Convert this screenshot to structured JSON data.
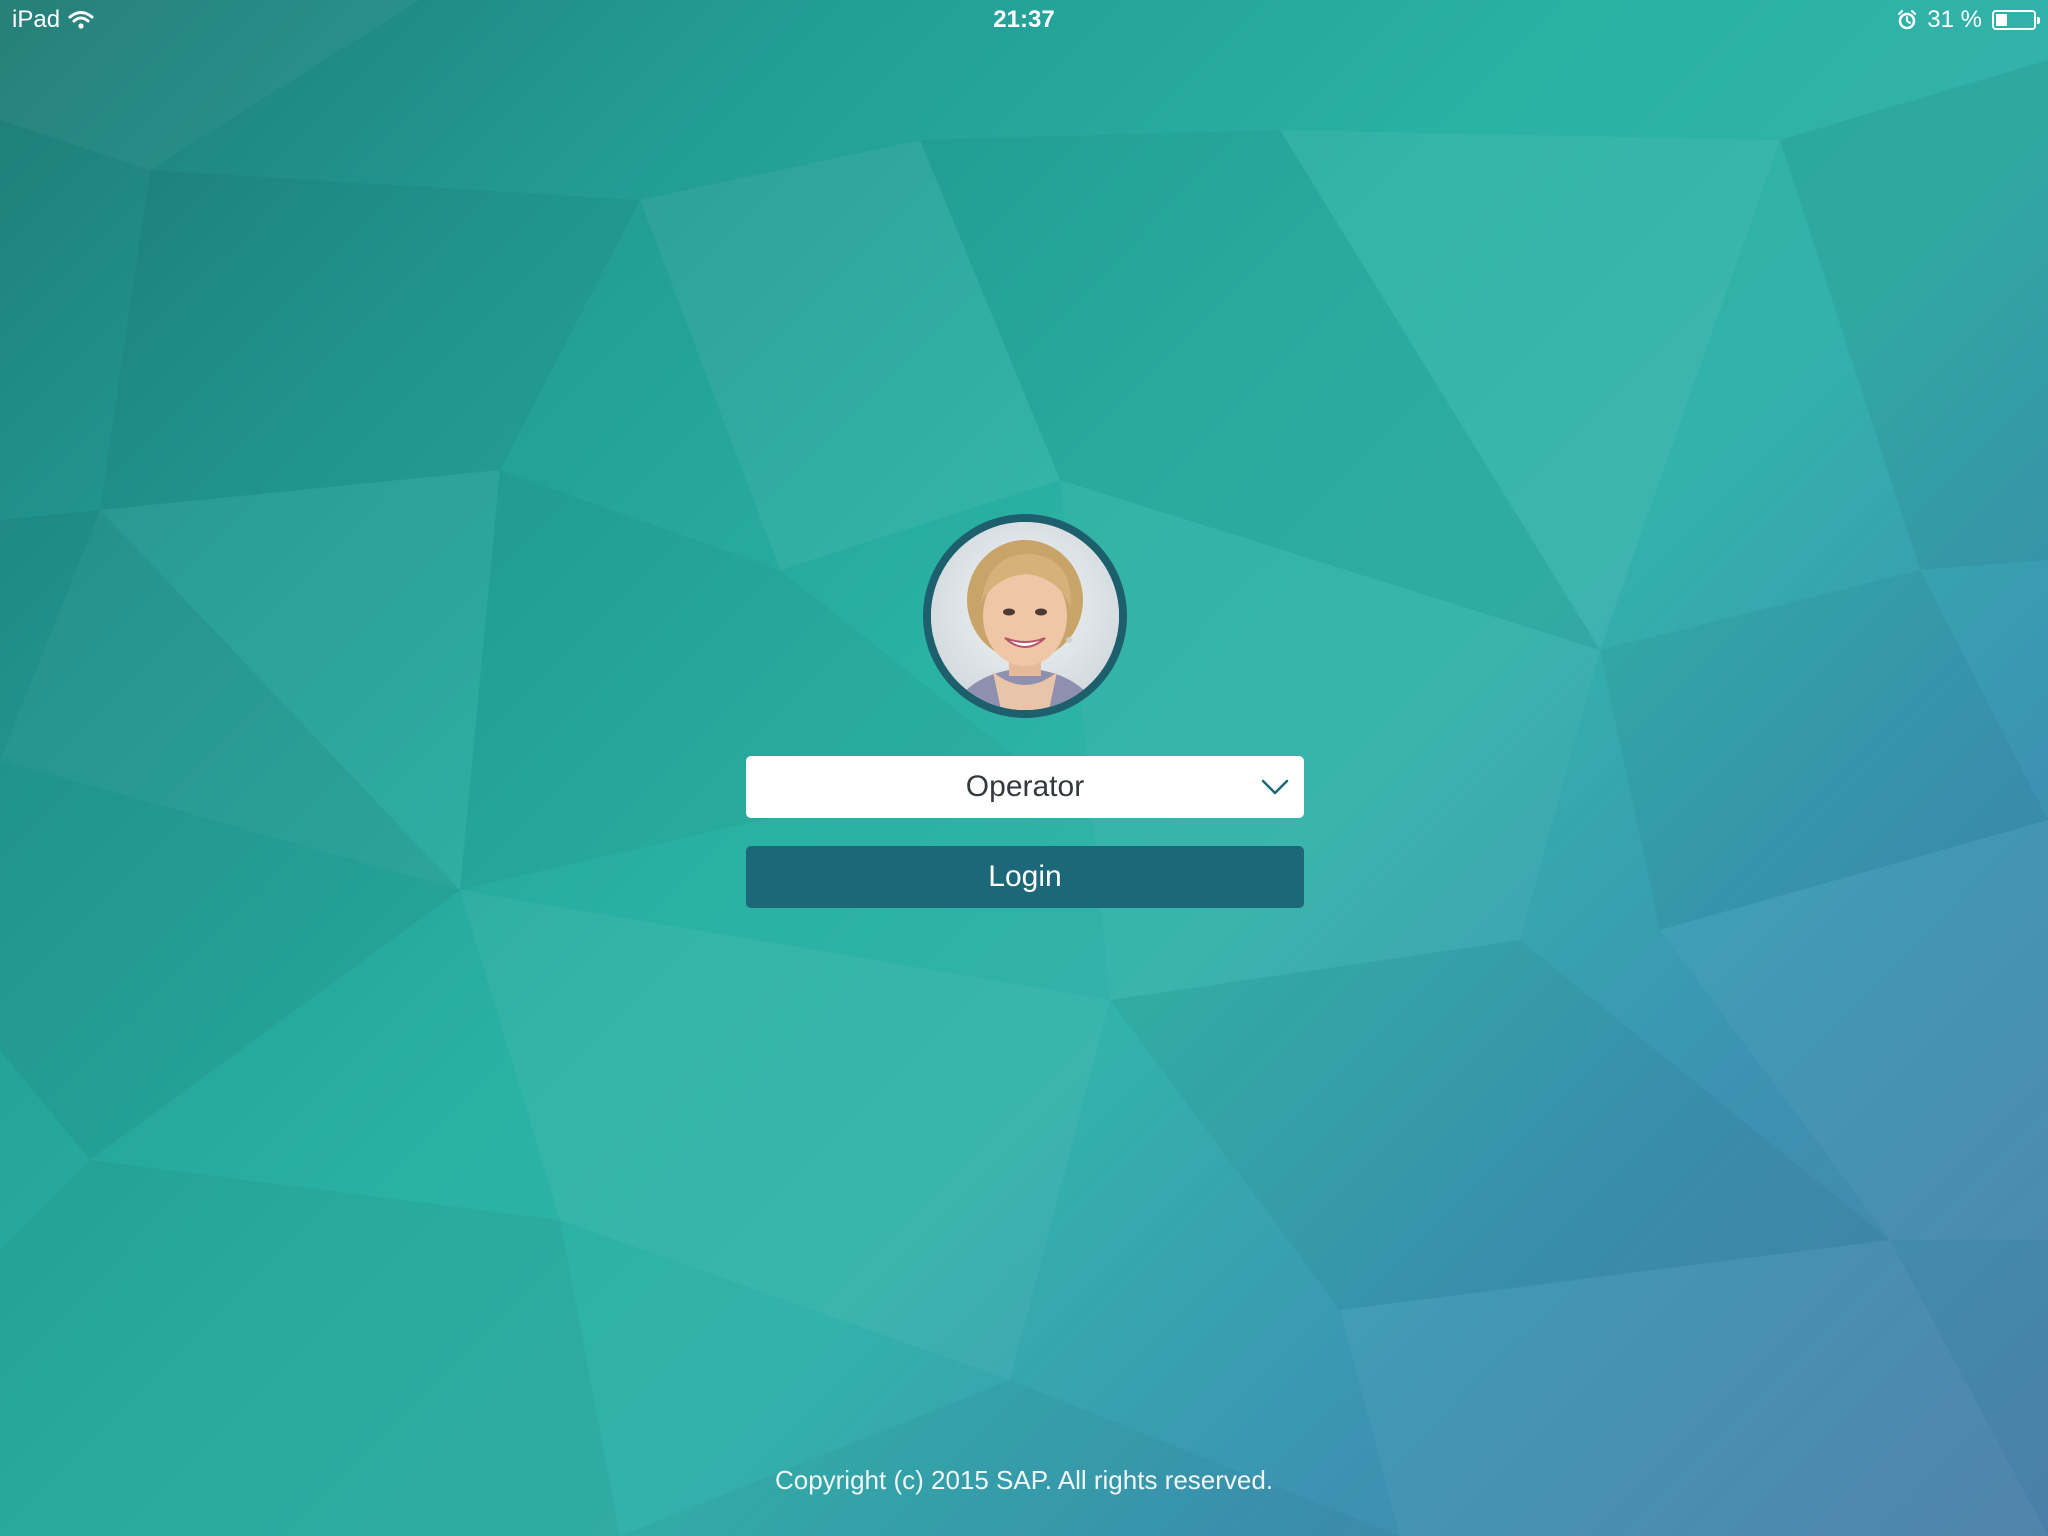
{
  "status_bar": {
    "device": "iPad",
    "time": "21:37",
    "battery_text": "31 %",
    "battery_level": 0.31,
    "icons": [
      "wifi-icon",
      "alarm-icon",
      "battery-icon"
    ]
  },
  "login": {
    "avatar_alt": "user-avatar",
    "role_selected": "Operator",
    "login_label": "Login"
  },
  "footer": {
    "copyright": "Copyright (c) 2015 SAP. All rights reserved."
  },
  "colors": {
    "login_button": "#1c6878",
    "avatar_ring": "#1e5f6e",
    "chevron": "#1c6878"
  }
}
